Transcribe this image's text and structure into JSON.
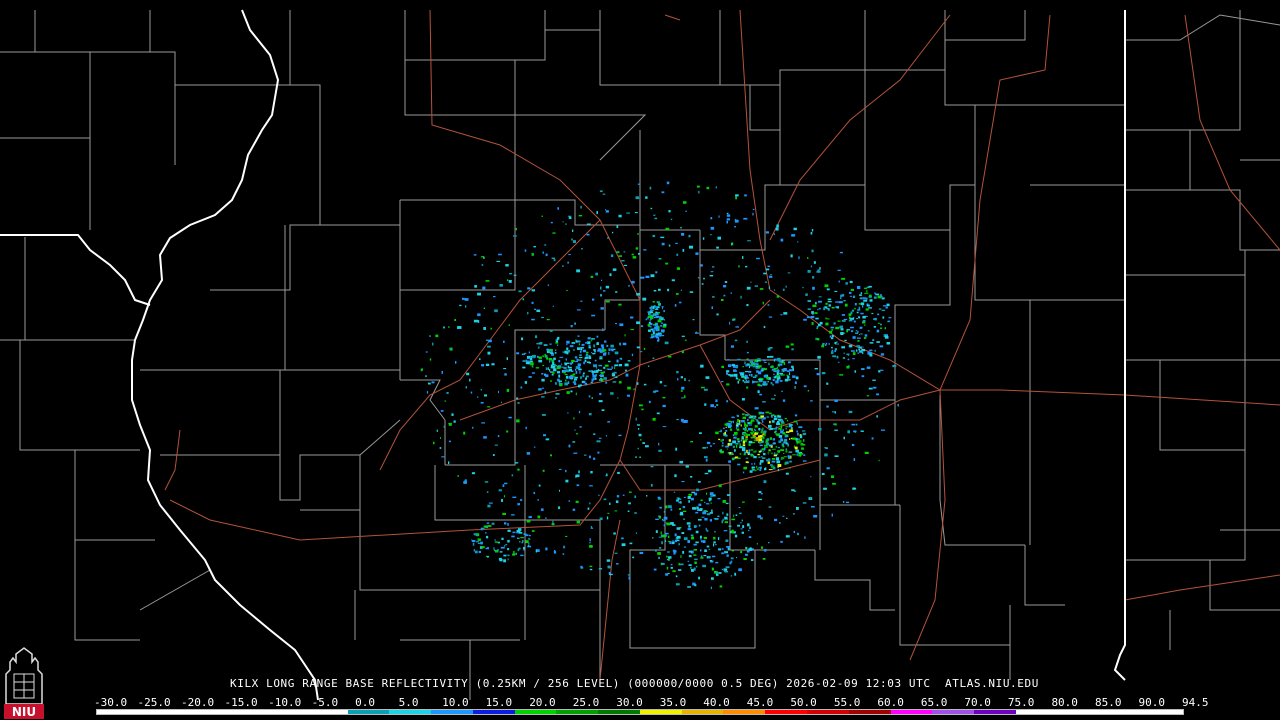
{
  "caption": "KILX LONG RANGE BASE REFLECTIVITY (0.25KM / 256 LEVEL) (000000/0000 0.5 DEG) 2026-02-09 12:03 UTC  ATLAS.NIU.EDU",
  "logo_text": "NIU",
  "scale": {
    "labels": [
      "-30.0",
      "-25.0",
      "-20.0",
      "-15.0",
      "-10.0",
      "-5.0",
      "0.0",
      "5.0",
      "10.0",
      "15.0",
      "20.0",
      "25.0",
      "30.0",
      "35.0",
      "40.0",
      "45.0",
      "50.0",
      "55.0",
      "60.0",
      "65.0",
      "70.0",
      "75.0",
      "80.0",
      "85.0",
      "90.0",
      "94.5"
    ],
    "colors": [
      "#ffffff",
      "#ffffff",
      "#ffffff",
      "#ffffff",
      "#ffffff",
      "#ffffff",
      "#0c9eb4",
      "#1ed2e6",
      "#1e96ff",
      "#0a1edc",
      "#00d200",
      "#00a000",
      "#007800",
      "#f0f000",
      "#e6b400",
      "#ff8c00",
      "#ff0000",
      "#d20000",
      "#a00000",
      "#ff00ff",
      "#a050e6",
      "#7000c0",
      "#ffffff",
      "#ffffff",
      "#ffffff",
      "#ffffff"
    ]
  },
  "colors": {
    "background": "#000000",
    "county_lines": "#9a9a9a",
    "state_lines": "#ffffff",
    "highways": "#b4533a"
  }
}
